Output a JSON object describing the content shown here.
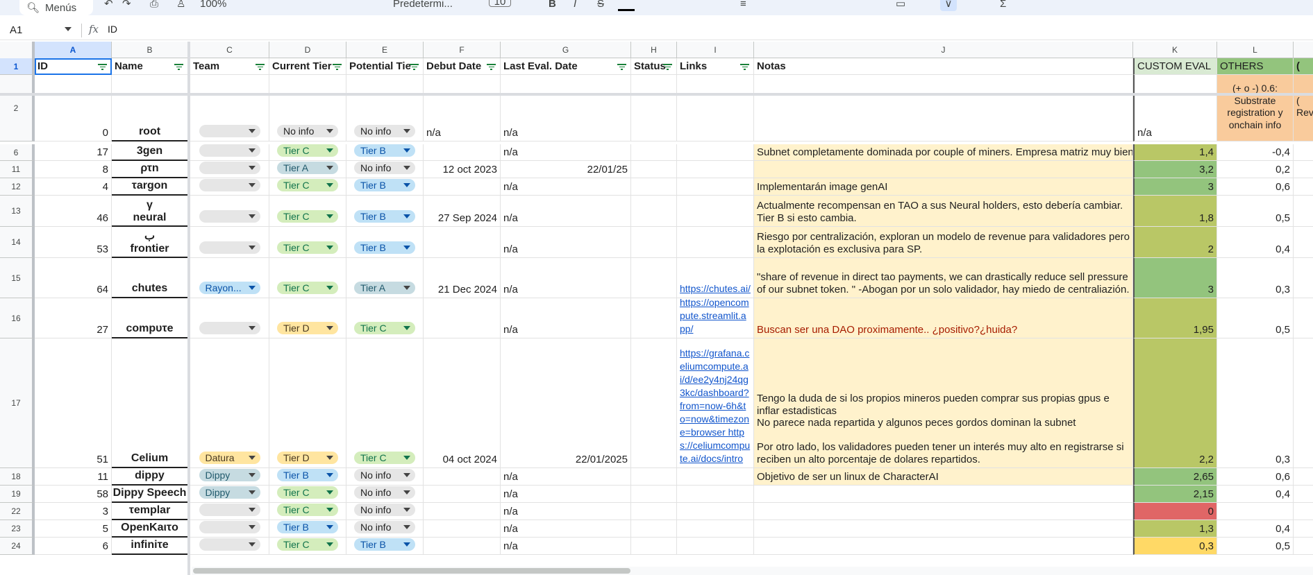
{
  "toolbar": {
    "search": "Menús",
    "zoom": "100%",
    "font": "Predetermi...",
    "size": "10"
  },
  "formula": {
    "cell": "A1",
    "fx": "fx",
    "value": "ID"
  },
  "columns": [
    "A",
    "B",
    "C",
    "D",
    "E",
    "F",
    "G",
    "H",
    "I",
    "J",
    "K",
    "L"
  ],
  "headers": {
    "id": "ID",
    "name": "Name",
    "team": "Team",
    "current": "Current Tier",
    "potential": "Potential Tie",
    "debut": "Debut Date",
    "last_eval": "Last Eval. Date",
    "status": "Status",
    "links": "Links",
    "notas": "Notas",
    "custom": "CUSTOM EVAL",
    "others": "OTHERS",
    "m_partial": "("
  },
  "row2": {
    "id": "0",
    "name": "root",
    "current": "No info",
    "potential": "No info",
    "debut": "n/a",
    "last_eval": "n/a",
    "custom": "n/a",
    "others_note": "(+ o -) 0.6: Substrate registration y onchain info",
    "m_partial": "( Rev"
  },
  "rows": [
    {
      "rn": "6",
      "id": "17",
      "name": "3gen",
      "team": "",
      "current": "Tier C",
      "potential": "Tier B",
      "debut": "",
      "last": "n/a",
      "link": "",
      "notas": "Subnet completamente dominada por couple of miners. Empresa matriz muy bien c",
      "k": "1,4",
      "l": "-0,4"
    },
    {
      "rn": "11",
      "id": "8",
      "name": "ρτn",
      "team": "",
      "current": "Tier A",
      "potential": "No info",
      "debut": "12 oct 2023",
      "last": "22/01/25",
      "link": "",
      "notas": "",
      "k": "3,2",
      "l": "0,2"
    },
    {
      "rn": "12",
      "id": "4",
      "name": "τargon",
      "team": "",
      "current": "Tier C",
      "potential": "Tier B",
      "debut": "",
      "last": "n/a",
      "link": "",
      "notas": "Implementarán image genAI",
      "k": "3",
      "l": "0,6"
    },
    {
      "rn": "13",
      "id": "46",
      "name": "neural",
      "sym": "γ",
      "team": "",
      "current": "Tier C",
      "potential": "Tier B",
      "debut": "27 Sep 2024",
      "last": "n/a",
      "link": "",
      "notas": "Actualmente recompensan en TAO a sus Neural holders, esto debería cambiar. Tier B si esto cambia.",
      "k": "1,8",
      "l": "0,5"
    },
    {
      "rn": "14",
      "id": "53",
      "name": "frontier",
      "sym": "ب",
      "team": "",
      "current": "Tier C",
      "potential": "Tier B",
      "debut": "",
      "last": "n/a",
      "link": "",
      "notas": "Riesgo por centralización, exploran un modelo de revenue para validadores pero la explotación es exclusiva para SP.",
      "k": "2",
      "l": "0,4"
    },
    {
      "rn": "15",
      "id": "64",
      "name": "chutes",
      "team": "Rayon...",
      "current": "Tier C",
      "potential": "Tier A",
      "debut": "21 Dec 2024",
      "last": "n/a",
      "link": "https://chutes.ai/",
      "notas": "\"share of revenue in direct tao payments, we can drastically reduce sell pressure of our subnet token. \" -Abogan por un solo validador, hay miedo de centraliazión.",
      "k": "3",
      "l": "0,3"
    },
    {
      "rn": "16",
      "id": "27",
      "name": "compυτe",
      "team": "",
      "current": "Tier D",
      "potential": "Tier C",
      "debut": "",
      "last": "n/a",
      "link": "https://opencompute.streamlit.app/",
      "notas": "Buscan ser una DAO proximamente.. ¿positivo?¿huida?",
      "k": "1,95",
      "l": "0,5"
    },
    {
      "rn": "17",
      "id": "51",
      "name": "Celium",
      "team": "Datura",
      "current": "Tier D",
      "potential": "Tier C",
      "debut": "04 oct 2024",
      "last": "22/01/2025",
      "link": "https://grafana.celiumcompute.ai/d/ee2y4nj24qg3kc/dashboard?from=now-6h&to=now&timezone=browser https://celiumcompute.ai/docs/intro",
      "notas": "Tengo la duda de si los propios mineros pueden comprar sus propias gpus e inflar estadisticas\nNo parece nada repartida y algunos peces gordos dominan la subnet\n\nPor otro lado, los validadores pueden tener un interés muy alto en registrarse si reciben un alto porcentaje de dolares repartidos.",
      "k": "2,2",
      "l": "0,3"
    },
    {
      "rn": "18",
      "id": "11",
      "name": "dippy",
      "team": "Dippy",
      "current": "Tier B",
      "potential": "No info",
      "debut": "",
      "last": "n/a",
      "link": "",
      "notas": "Objetivo de ser un linux de CharacterAI",
      "k": "2,65",
      "l": "0,6"
    },
    {
      "rn": "19",
      "id": "58",
      "name": "Dippy Speech",
      "team": "Dippy",
      "current": "Tier C",
      "potential": "No info",
      "debut": "",
      "last": "n/a",
      "link": "",
      "notas": "",
      "k": "2,15",
      "l": "0,4"
    },
    {
      "rn": "22",
      "id": "3",
      "name": "τemplar",
      "team": "",
      "current": "Tier C",
      "potential": "No info",
      "debut": "",
      "last": "n/a",
      "link": "",
      "notas": "",
      "k": "0",
      "l": ""
    },
    {
      "rn": "23",
      "id": "5",
      "name": "OpenKaιτo",
      "team": "",
      "current": "Tier B",
      "potential": "No info",
      "debut": "",
      "last": "n/a",
      "link": "",
      "notas": "",
      "k": "1,3",
      "l": "0,4"
    },
    {
      "rn": "24",
      "id": "6",
      "name": "infiniτe",
      "team": "",
      "current": "Tier C",
      "potential": "Tier B",
      "debut": "",
      "last": "n/a",
      "link": "",
      "notas": "",
      "k": "0,3",
      "l": "0,5"
    }
  ],
  "colors": {
    "k_green": "#93c47d",
    "k_olive": "#b9c766",
    "k_red": "#e06666",
    "k_yellow": "#ffd966",
    "notes_bg": "#fff2cc",
    "others_bg": "#f9cb9c",
    "header_green": "#d9ead3"
  }
}
